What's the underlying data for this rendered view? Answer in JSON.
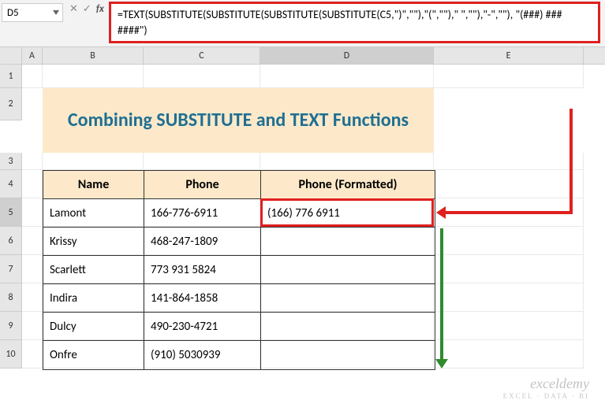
{
  "namebox": {
    "value": "D5"
  },
  "formula": "=TEXT(SUBSTITUTE(SUBSTITUTE(SUBSTITUTE(SUBSTITUTE(C5,\")\",\"\"),\"(\",\"\"),\" \",\"\"),\"-\",\"\"), \"(###) ### ####\")",
  "columns": {
    "A": "A",
    "B": "B",
    "C": "C",
    "D": "D",
    "E": "E"
  },
  "rows": [
    "1",
    "2",
    "3",
    "4",
    "5",
    "6",
    "7",
    "8",
    "9",
    "10"
  ],
  "title": "Combining SUBSTITUTE and TEXT Functions",
  "headers": {
    "name": "Name",
    "phone": "Phone",
    "formatted": "Phone (Formatted)"
  },
  "data": [
    {
      "name": "Lamont",
      "phone": "166-776-6911",
      "formatted": "(166) 776 6911"
    },
    {
      "name": "Krissy",
      "phone": "468-247-1809",
      "formatted": ""
    },
    {
      "name": "Scarlett",
      "phone": "773 931 5824",
      "formatted": ""
    },
    {
      "name": "Indira",
      "phone": "141-864-1858",
      "formatted": ""
    },
    {
      "name": "Dulcy",
      "phone": "490-230-4721",
      "formatted": ""
    },
    {
      "name": "Onfre",
      "phone": "(910) 5030939",
      "formatted": ""
    }
  ],
  "watermark": {
    "main": "exceldemy",
    "sub": "EXCEL · DATA · BI"
  }
}
